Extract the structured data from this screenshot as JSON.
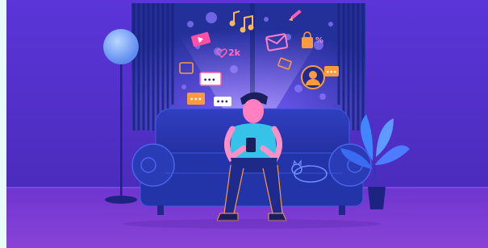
{
  "illustration": {
    "likes_count": "2k",
    "discount_symbol": "%",
    "typing_dots": "•••"
  },
  "colors": {
    "wall_top": "#5a36d6",
    "wall_bottom": "#4c2bc2",
    "floor": "#7c3bd1",
    "sofa": "#2c3bb4",
    "sofa_shadow": "#1e2887",
    "window_dark": "#1f2b8f",
    "lamp_glow": "#78a8ff",
    "accent_orange": "#ff9a3d",
    "accent_pink": "#ff5db1",
    "accent_cyan": "#35d4ff",
    "shirt": "#35c3ea",
    "plant": "#3f86ff"
  },
  "icons": [
    "play-card-icon",
    "music-note-icon",
    "heart-icon",
    "email-icon",
    "shopping-bag-icon",
    "pencil-icon",
    "chat-bubble-icon",
    "avatar-icon",
    "lamp-icon",
    "cat-icon",
    "plant-icon"
  ]
}
